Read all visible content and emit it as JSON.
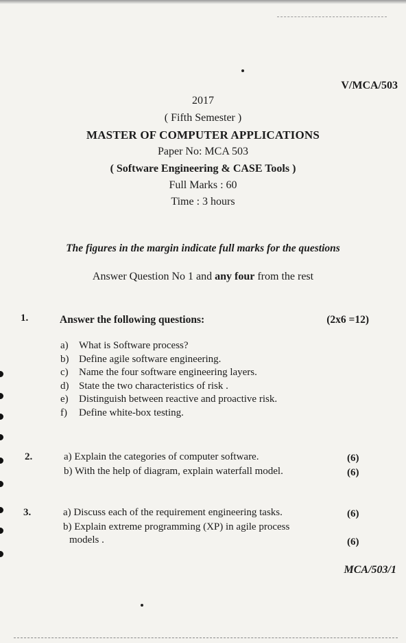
{
  "header": {
    "code": "V/MCA/503",
    "year": "2017",
    "semester": "( Fifth Semester )",
    "program": "MASTER OF COMPUTER APPLICATIONS",
    "paper": "Paper No:  MCA 503",
    "subject": "( Software Engineering & CASE Tools )",
    "full_marks": "Full Marks  : 60",
    "time": "Time : 3 hours"
  },
  "instructions": {
    "margin_note": "The figures in the margin indicate full marks for the questions",
    "answer_prefix": "Answer Question No 1 and ",
    "answer_bold": "any four",
    "answer_suffix": " from the rest"
  },
  "questions": [
    {
      "number": "1.",
      "heading": "Answer the following questions:",
      "marks": "(2x6 =12)",
      "items": [
        {
          "label": "a)",
          "text": "What is Software process?"
        },
        {
          "label": "b)",
          "text": "Define agile software engineering."
        },
        {
          "label": "c)",
          "text": "Name the four software engineering layers."
        },
        {
          "label": "d)",
          "text": "State the two characteristics of risk ."
        },
        {
          "label": "e)",
          "text": "Distinguish between reactive and proactive risk."
        },
        {
          "label": "f)",
          "text": "Define white-box testing."
        }
      ]
    },
    {
      "number": "2.",
      "items": [
        {
          "text": "a)  Explain the categories of computer software.",
          "marks": "(6)"
        },
        {
          "text": "b)  With the help of diagram, explain waterfall model.",
          "marks": "(6)"
        }
      ]
    },
    {
      "number": "3.",
      "items": [
        {
          "text": "a) Discuss each of the requirement engineering tasks.",
          "marks": "(6)"
        },
        {
          "text": "b) Explain extreme programming (XP) in agile process",
          "marks": ""
        },
        {
          "text": "models .",
          "marks": "(6)"
        }
      ]
    }
  ],
  "footer": {
    "code": "MCA/503/1"
  }
}
